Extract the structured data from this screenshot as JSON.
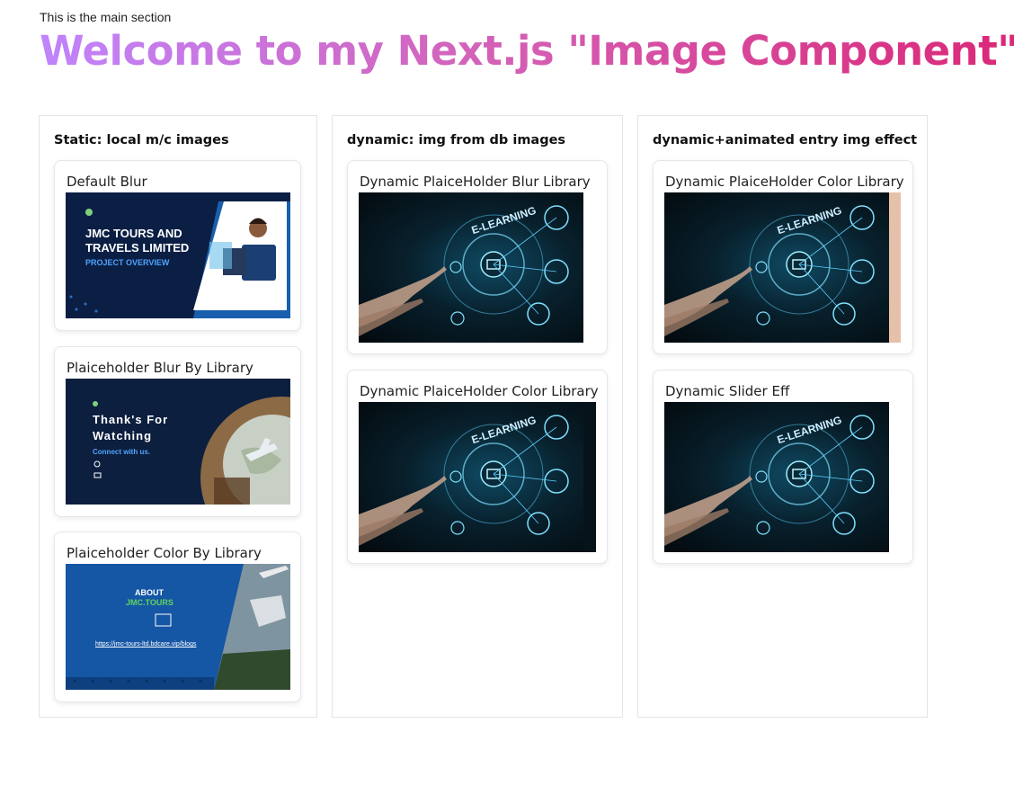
{
  "intro_text": "This is the main section",
  "hero_title": "Welcome to my Next.js \"Image Component\"",
  "columns": [
    {
      "title": "Static: local m/c images",
      "cards": [
        {
          "label": "Default Blur",
          "image": {
            "line1": "JMC TOURS AND",
            "line2": "TRAVELS LIMITED",
            "line3": "PROJECT OVERVIEW"
          }
        },
        {
          "label": "Plaiceholder Blur By Library",
          "image": {
            "line1": "Thank's For",
            "line2": "Watching",
            "line3": "Connect with us."
          }
        },
        {
          "label": "Plaiceholder Color By Library",
          "image": {
            "line1": "ABOUT",
            "line2": "JMC.TOURS",
            "line3": "https://jmc-tours-ltd.bdcare.vip/blogs"
          }
        }
      ]
    },
    {
      "title": "dynamic: img from db images",
      "cards": [
        {
          "label": "Dynamic PlaiceHolder Blur Library",
          "image": {
            "text": "E-LEARNING"
          }
        },
        {
          "label": "Dynamic PlaiceHolder Color Library",
          "image": {
            "text": "E-LEARNING"
          }
        }
      ]
    },
    {
      "title": "dynamic+animated entry img effect",
      "cards": [
        {
          "label": "Dynamic PlaiceHolder Color Library",
          "image": {
            "text": "E-LEARNING"
          }
        },
        {
          "label": "Dynamic Slider Eff",
          "image": {
            "text": "E-LEARNING"
          }
        }
      ]
    }
  ],
  "colors": {
    "hero_start": "#c084fc",
    "hero_end": "#db2777",
    "placeholder_color": "#e6c1aa"
  }
}
